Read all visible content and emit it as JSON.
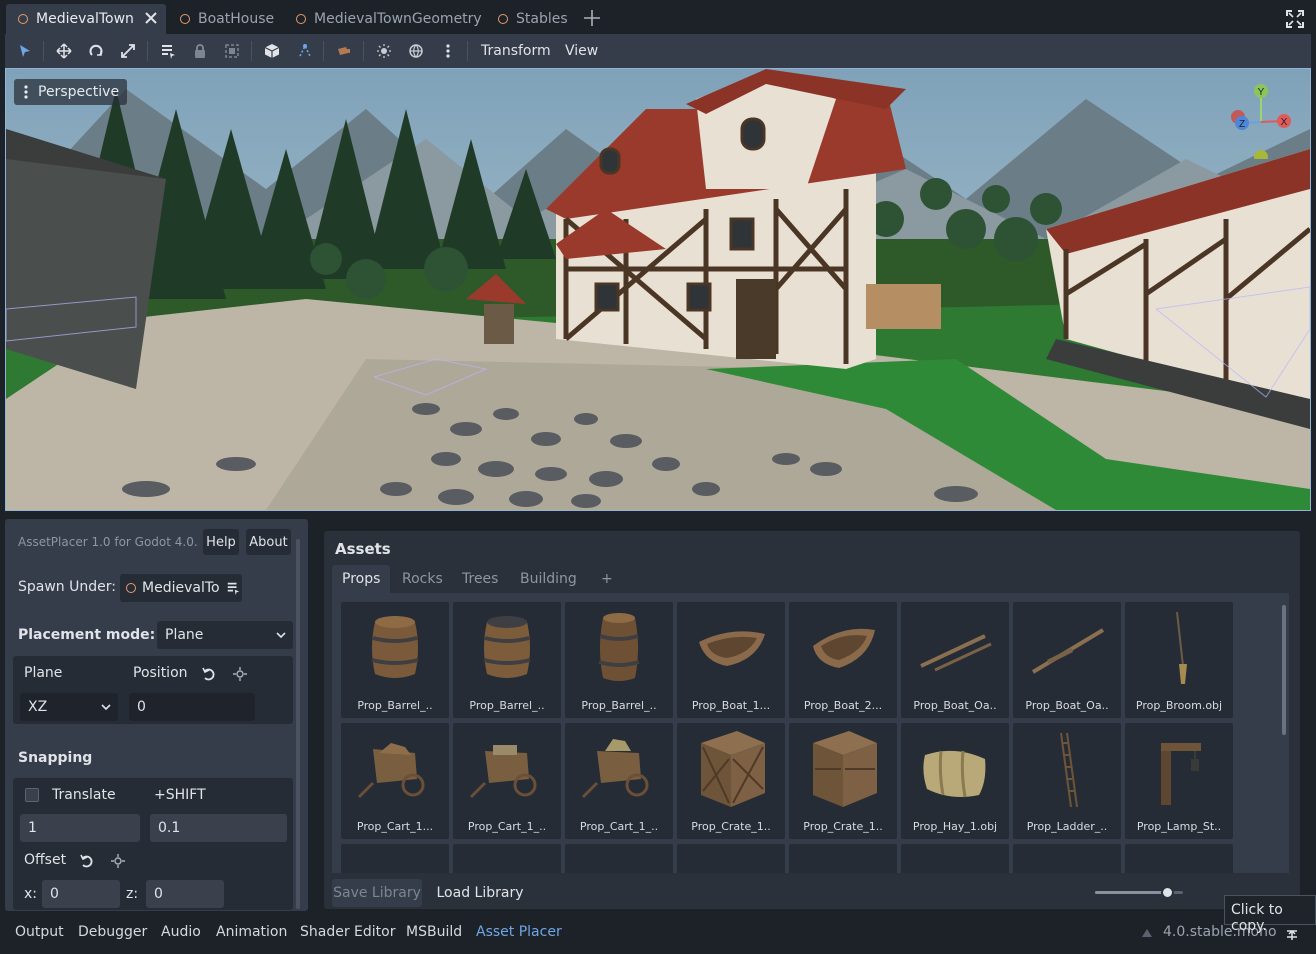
{
  "scene_tabs": [
    {
      "label": "MedievalTown",
      "active": true
    },
    {
      "label": "BoatHouse",
      "active": false
    },
    {
      "label": "MedievalTownGeometry",
      "active": false
    },
    {
      "label": "Stables",
      "active": false
    }
  ],
  "toolbar": {
    "transform_menu": "Transform",
    "view_menu": "View"
  },
  "viewport": {
    "perspective_label": "Perspective",
    "gizmo": {
      "y": "Y",
      "z": "Z",
      "x": "X"
    }
  },
  "asset_placer": {
    "version": "AssetPlacer 1.0 for Godot 4.0.",
    "help_button": "Help",
    "about_button": "About",
    "spawn_under_label": "Spawn Under:",
    "spawn_under_value": "MedievalTo",
    "placement_mode_label": "Placement mode:",
    "placement_mode_value": "Plane",
    "plane_label": "Plane",
    "position_label": "Position",
    "plane_value": "XZ",
    "position_value": "0",
    "snapping_label": "Snapping",
    "translate_label": "Translate",
    "shift_label": "+SHIFT",
    "translate_value": "1",
    "shift_value": "0.1",
    "offset_label": "Offset",
    "x_label": "x:",
    "x_value": "0",
    "z_label": "z:",
    "z_value": "0"
  },
  "assets": {
    "title": "Assets",
    "tabs": [
      "Props",
      "Rocks",
      "Trees",
      "Building",
      "+"
    ],
    "active_tab": "Props",
    "items_row1": [
      "Prop_Barrel_..",
      "Prop_Barrel_..",
      "Prop_Barrel_..",
      "Prop_Boat_1...",
      "Prop_Boat_2...",
      "Prop_Boat_Oa..",
      "Prop_Boat_Oa..",
      "Prop_Broom.obj"
    ],
    "items_row2": [
      "Prop_Cart_1...",
      "Prop_Cart_1_..",
      "Prop_Cart_1_..",
      "Prop_Crate_1..",
      "Prop_Crate_1..",
      "Prop_Hay_1.obj",
      "Prop_Ladder_..",
      "Prop_Lamp_St.."
    ],
    "save_library": "Save Library",
    "load_library": "Load Library",
    "thumbnail_size": 0.82
  },
  "bottom_panel": {
    "tabs": [
      "Output",
      "Debugger",
      "Audio",
      "Animation",
      "Shader Editor",
      "MSBuild",
      "Asset Placer"
    ],
    "active_tab": "Asset Placer",
    "version": "4.0.stable.mono"
  },
  "tooltip": "Click to copy.",
  "colors": {
    "accent": "#6ea6e6",
    "background": "#1d2229",
    "panel": "#363d4a",
    "field": "#262c35",
    "scene_icon": "#e39b6c"
  }
}
